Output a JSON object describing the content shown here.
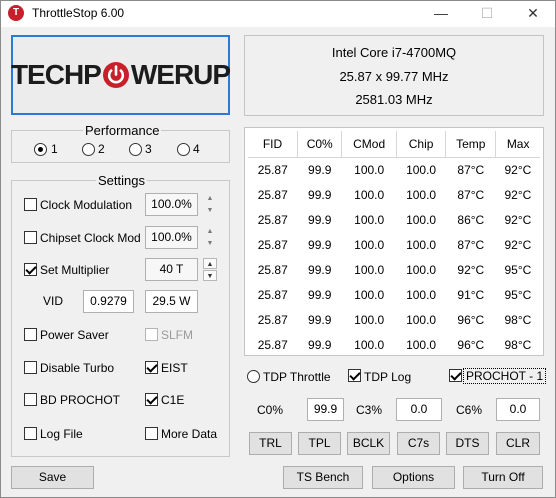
{
  "window": {
    "title": "ThrottleStop 6.00",
    "icon_letter": "T",
    "minimize": "—",
    "maximize": "☐",
    "close": "✕"
  },
  "logo": {
    "part1": "TECHP",
    "part2": "WERUP",
    "brand_color": "#c8202a"
  },
  "cpu": {
    "name": "Intel Core i7-4700MQ",
    "multiplier": "25.87 x 99.77 MHz",
    "frequency": "2581.03 MHz"
  },
  "performance": {
    "title": "Performance",
    "profiles": [
      {
        "label": "1",
        "selected": true
      },
      {
        "label": "2",
        "selected": false
      },
      {
        "label": "3",
        "selected": false
      },
      {
        "label": "4",
        "selected": false
      }
    ]
  },
  "settings": {
    "title": "Settings",
    "clock_modulation": {
      "label": "Clock Modulation",
      "checked": false,
      "value": "100.0%"
    },
    "chipset_clock_mod": {
      "label": "Chipset Clock Mod",
      "checked": false,
      "value": "100.0%"
    },
    "set_multiplier": {
      "label": "Set Multiplier",
      "checked": true,
      "value": "40 T"
    },
    "vid": {
      "label": "VID",
      "value": "0.9279",
      "power": "29.5 W"
    },
    "power_saver": {
      "label": "Power Saver",
      "checked": false
    },
    "slfm": {
      "label": "SLFM",
      "checked": false,
      "disabled": true
    },
    "disable_turbo": {
      "label": "Disable Turbo",
      "checked": false
    },
    "eist": {
      "label": "EIST",
      "checked": true
    },
    "bd_prochot": {
      "label": "BD PROCHOT",
      "checked": false
    },
    "c1e": {
      "label": "C1E",
      "checked": true
    },
    "log_file": {
      "label": "Log File",
      "checked": false
    },
    "more_data": {
      "label": "More Data",
      "checked": false
    }
  },
  "table": {
    "headers": [
      "FID",
      "C0%",
      "CMod",
      "Chip",
      "Temp",
      "Max"
    ],
    "rows": [
      [
        "25.87",
        "99.9",
        "100.0",
        "100.0",
        "87°C",
        "92°C"
      ],
      [
        "25.87",
        "99.9",
        "100.0",
        "100.0",
        "87°C",
        "92°C"
      ],
      [
        "25.87",
        "99.9",
        "100.0",
        "100.0",
        "86°C",
        "92°C"
      ],
      [
        "25.87",
        "99.9",
        "100.0",
        "100.0",
        "87°C",
        "92°C"
      ],
      [
        "25.87",
        "99.9",
        "100.0",
        "100.0",
        "92°C",
        "95°C"
      ],
      [
        "25.87",
        "99.9",
        "100.0",
        "100.0",
        "91°C",
        "95°C"
      ],
      [
        "25.87",
        "99.9",
        "100.0",
        "100.0",
        "96°C",
        "98°C"
      ],
      [
        "25.87",
        "99.9",
        "100.0",
        "100.0",
        "96°C",
        "98°C"
      ]
    ]
  },
  "status": {
    "tdp_throttle": {
      "label": "TDP Throttle",
      "selected": false
    },
    "tdp_log": {
      "label": "TDP Log",
      "checked": true
    },
    "prochot": {
      "label": "PROCHOT - 1",
      "checked": true
    }
  },
  "cstates": [
    {
      "label": "C0%",
      "value": "99.9"
    },
    {
      "label": "C3%",
      "value": "0.0"
    },
    {
      "label": "C6%",
      "value": "0.0"
    }
  ],
  "tool_buttons": [
    "TRL",
    "TPL",
    "BCLK",
    "C7s",
    "DTS",
    "CLR"
  ],
  "footer": {
    "save": "Save",
    "ts_bench": "TS Bench",
    "options": "Options",
    "turn_off": "Turn Off"
  }
}
